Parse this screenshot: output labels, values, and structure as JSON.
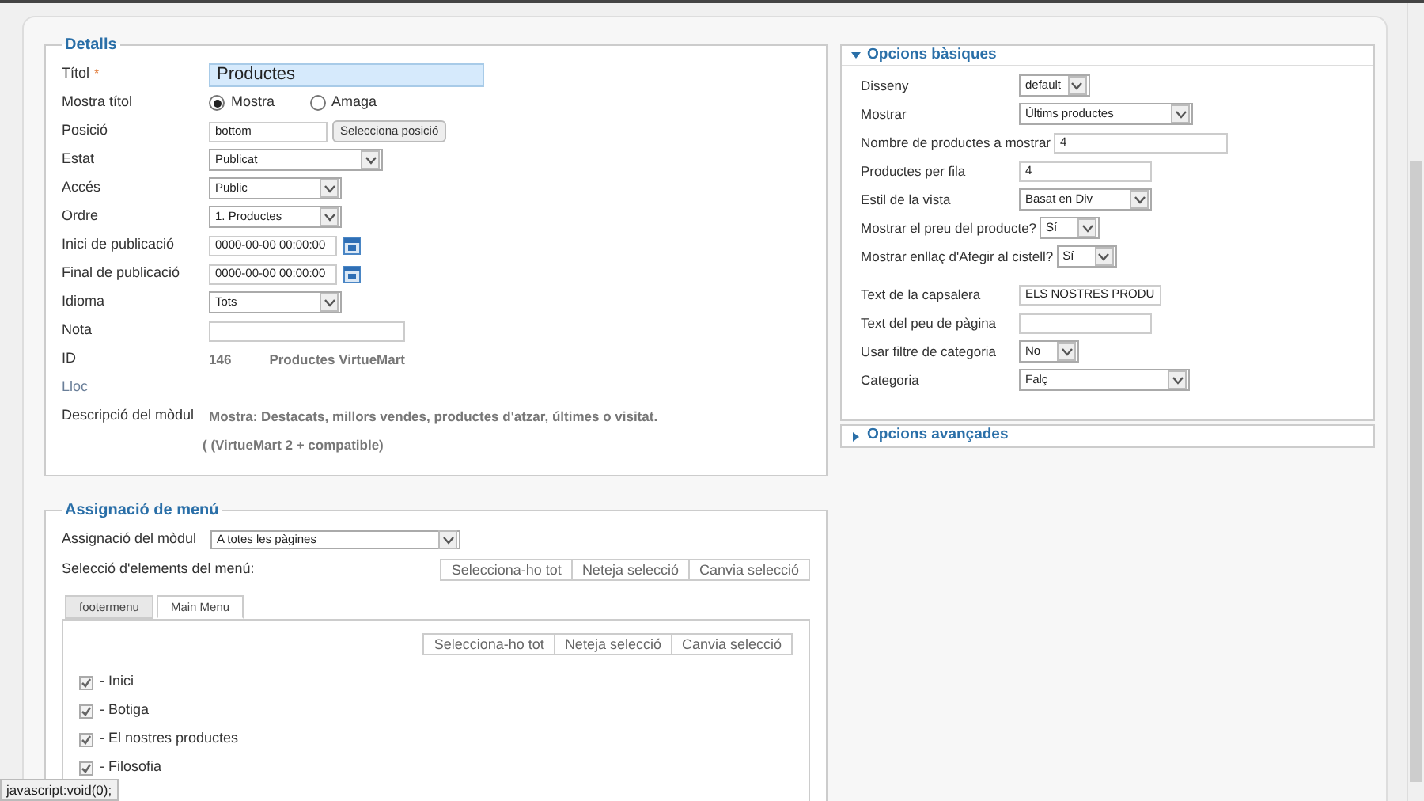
{
  "details": {
    "title": "Detalls",
    "rows": [
      {
        "label": "Títol",
        "required_mark": "*",
        "kind": "title",
        "value": "Productes"
      },
      {
        "label": "Mostra títol",
        "kind": "radio",
        "options": [
          {
            "label": "Mostra",
            "selected": true
          },
          {
            "label": "Amaga",
            "selected": false
          }
        ]
      },
      {
        "label": "Posició",
        "kind": "text_button",
        "value": "bottom",
        "button": "Selecciona posició"
      },
      {
        "label": "Estat",
        "kind": "select",
        "value": "Publicat"
      },
      {
        "label": "Accés",
        "kind": "select",
        "value": "Public"
      },
      {
        "label": "Ordre",
        "kind": "select",
        "value": "1. Productes"
      },
      {
        "label": "Inici de publicació",
        "kind": "date",
        "value": "0000-00-00 00:00:00"
      },
      {
        "label": "Final de publicació",
        "kind": "date",
        "value": "0000-00-00 00:00:00"
      },
      {
        "label": "Idioma",
        "kind": "select",
        "value": "Tots"
      },
      {
        "label": "Nota",
        "kind": "text"
      },
      {
        "label": "ID",
        "kind": "id",
        "value": "146",
        "extra": "Productes VirtueMart"
      },
      {
        "label": "Lloc",
        "kind": "muted"
      },
      {
        "label": "Descripció del mòdul",
        "kind": "info",
        "value": "Mostra: Destacats, millors vendes, productes d'atzar, últimes o visitat."
      }
    ],
    "note": "( (VirtueMart 2 + compatible)"
  },
  "menu_assignment": {
    "title": "Assignació de menú",
    "module_label": "Assignació del mòdul",
    "module_value": "A totes les pàgines",
    "selection_label": "Selecció d'elements del menú:",
    "buttons": [
      "Selecciona-ho tot",
      "Neteja selecció",
      "Canvia selecció"
    ],
    "tabs": [
      {
        "label": "footermenu",
        "selected": false
      },
      {
        "label": "Main Menu",
        "selected": true
      }
    ],
    "inner_buttons": [
      "Selecciona-ho tot",
      "Neteja selecció",
      "Canvia selecció"
    ],
    "items": [
      {
        "label": "- Inici",
        "checked": true
      },
      {
        "label": "- Botiga",
        "checked": true
      },
      {
        "label": "- El nostres productes",
        "checked": true
      },
      {
        "label": "- Filosofia",
        "checked": true
      }
    ]
  },
  "basic_options": {
    "title": "Opcions bàsiques",
    "expanded": true,
    "groups": [
      [
        {
          "label": "Disseny",
          "kind": "select",
          "value": "default"
        },
        {
          "label": "Mostrar",
          "kind": "select",
          "value": "Últims productes"
        },
        {
          "label": "Nombre de productes a mostrar",
          "kind": "text",
          "value": "4"
        },
        {
          "label": "Productes per fila",
          "kind": "text",
          "value": "4"
        },
        {
          "label": "Estil de la vista",
          "kind": "select",
          "value": "Basat en Div"
        },
        {
          "label": "Mostrar el preu del producte?",
          "kind": "select",
          "value": "Sí"
        },
        {
          "label": "Mostrar enllaç d'Afegir al cistell?",
          "kind": "select",
          "value": "Sí"
        }
      ],
      [
        {
          "label": "Text de la capsalera",
          "kind": "text",
          "value": "ELS NOSTRES PRODU"
        },
        {
          "label": "Text del peu de pàgina",
          "kind": "text"
        },
        {
          "label": "Usar filtre de categoria",
          "kind": "select",
          "value": "No"
        },
        {
          "label": "Categoria",
          "kind": "select",
          "value": "Falç"
        }
      ]
    ]
  },
  "advanced_options": {
    "title": "Opcions avançades",
    "expanded": false
  },
  "status_bar": "javascript:void(0);"
}
